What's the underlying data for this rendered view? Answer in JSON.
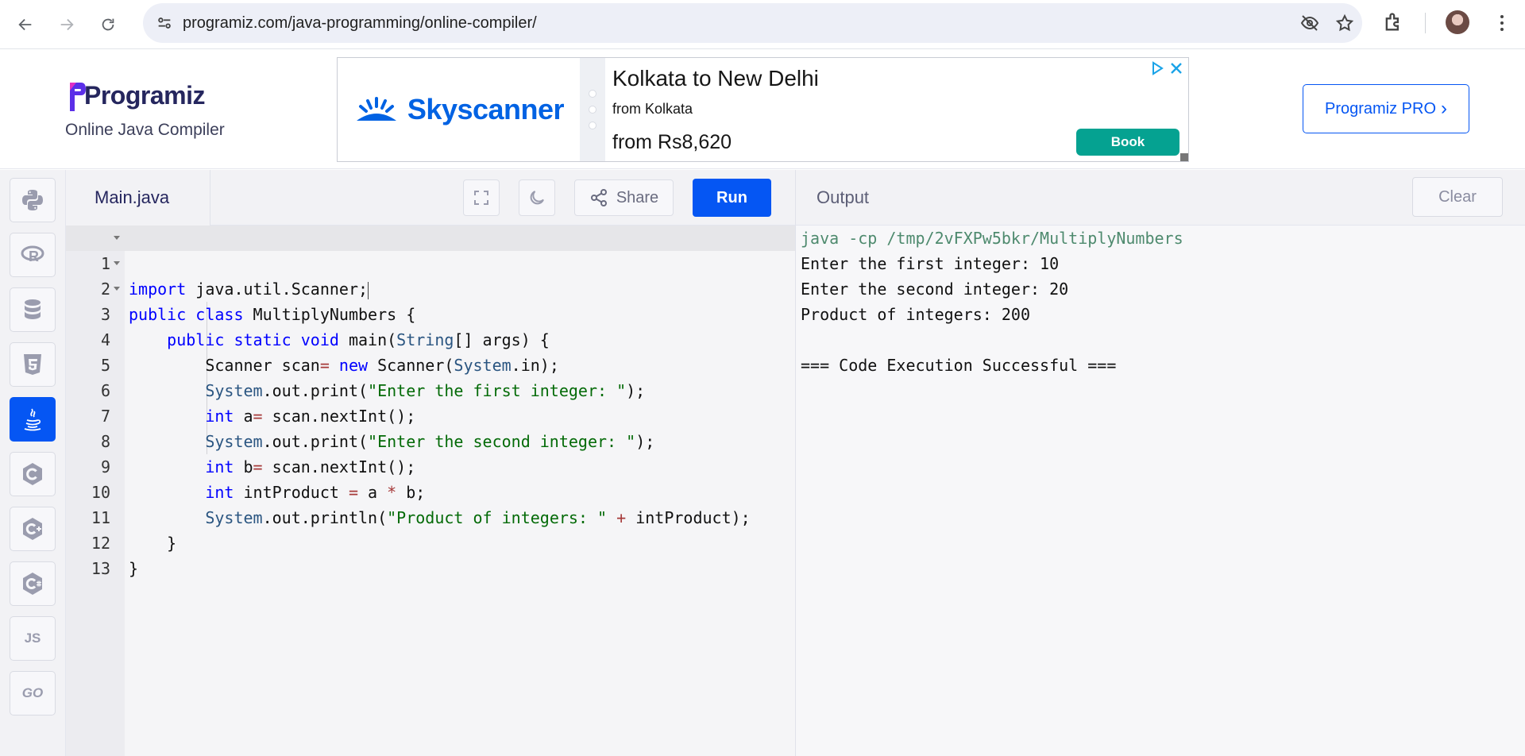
{
  "browser": {
    "url": "programiz.com/java-programming/online-compiler/"
  },
  "header": {
    "logo_text": "Programiz",
    "logo_subtitle": "Online Java Compiler",
    "pro_button": "Programiz PRO",
    "pro_chevron": "›"
  },
  "ad": {
    "brand": "Skyscanner",
    "title": "Kolkata to New Delhi",
    "from": "from Kolkata",
    "price": "from Rs8,620",
    "cta": "Book"
  },
  "sidebar": {
    "languages": [
      {
        "name": "python-icon",
        "active": false
      },
      {
        "name": "r-icon",
        "active": false
      },
      {
        "name": "sql-icon",
        "active": false
      },
      {
        "name": "html5-icon",
        "active": false
      },
      {
        "name": "java-icon",
        "active": true
      },
      {
        "name": "c-icon",
        "active": false
      },
      {
        "name": "cpp-icon",
        "active": false
      },
      {
        "name": "csharp-icon",
        "active": false
      },
      {
        "name": "js-icon",
        "label": "JS",
        "active": false
      },
      {
        "name": "go-icon",
        "label": "GO",
        "active": false
      }
    ]
  },
  "editor": {
    "file_name": "Main.java",
    "share_label": "Share",
    "run_label": "Run",
    "line_numbers": [
      "1",
      "2",
      "3",
      "4",
      "5",
      "6",
      "7",
      "8",
      "9",
      "10",
      "11",
      "12",
      "13"
    ],
    "code_lines": [
      "import java.util.Scanner;",
      "public class MultiplyNumbers {",
      "    public static void main(String[] args) {",
      "        Scanner scan= new Scanner(System.in);",
      "        System.out.print(\"Enter the first integer: \");",
      "        int a= scan.nextInt();",
      "        System.out.print(\"Enter the second integer: \");",
      "        int b= scan.nextInt();",
      "        int intProduct = a * b;",
      "        System.out.println(\"Product of integers: \" + intProduct);",
      "    }",
      "}",
      ""
    ]
  },
  "output": {
    "title": "Output",
    "clear_label": "Clear",
    "lines": [
      "java -cp /tmp/2vFXPw5bkr/MultiplyNumbers",
      "Enter the first integer: 10",
      "Enter the second integer: 20",
      "Product of integers: 200",
      "",
      "=== Code Execution Successful ==="
    ]
  },
  "colors": {
    "accent": "#0556f3",
    "ad_button": "#05a291",
    "keyword": "#0000ff",
    "string": "#036a07"
  }
}
